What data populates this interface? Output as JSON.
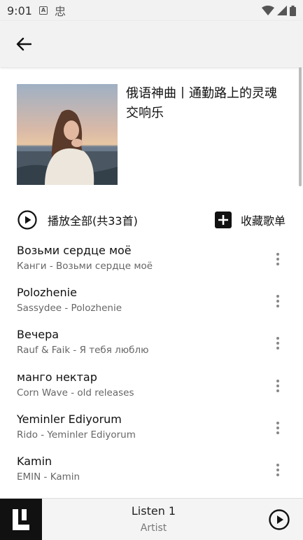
{
  "status_bar": {
    "time": "9:01",
    "notif_icon_letter": "A",
    "notif_icon2": "忠"
  },
  "app_bar": {
    "back_icon": "arrow-left-icon"
  },
  "playlist": {
    "title": "俄语神曲丨通勤路上的灵魂交响乐",
    "play_all_label": "播放全部(共33首)",
    "collect_label": "收藏歌单"
  },
  "songs": [
    {
      "title": "Возьми сердце моё",
      "subtitle": "Канги - Возьми сердце моё"
    },
    {
      "title": "Polozhenie",
      "subtitle": "Sassydee - Polozhenie"
    },
    {
      "title": "Вечера",
      "subtitle": "Rauf & Faik - Я тебя люблю"
    },
    {
      "title": "манго нектар",
      "subtitle": "Corn Wave - old releases"
    },
    {
      "title": "Yeminler Ediyorum",
      "subtitle": "Rido - Yeminler Ediyorum"
    },
    {
      "title": "Kamin",
      "subtitle": "EMIN - Kamin"
    }
  ],
  "player": {
    "title": "Listen 1",
    "artist": "Artist"
  },
  "colors": {
    "app_bar_bg": "#f2f2f2",
    "player_thumb_bg": "#111111",
    "secondary_text": "#666666"
  }
}
